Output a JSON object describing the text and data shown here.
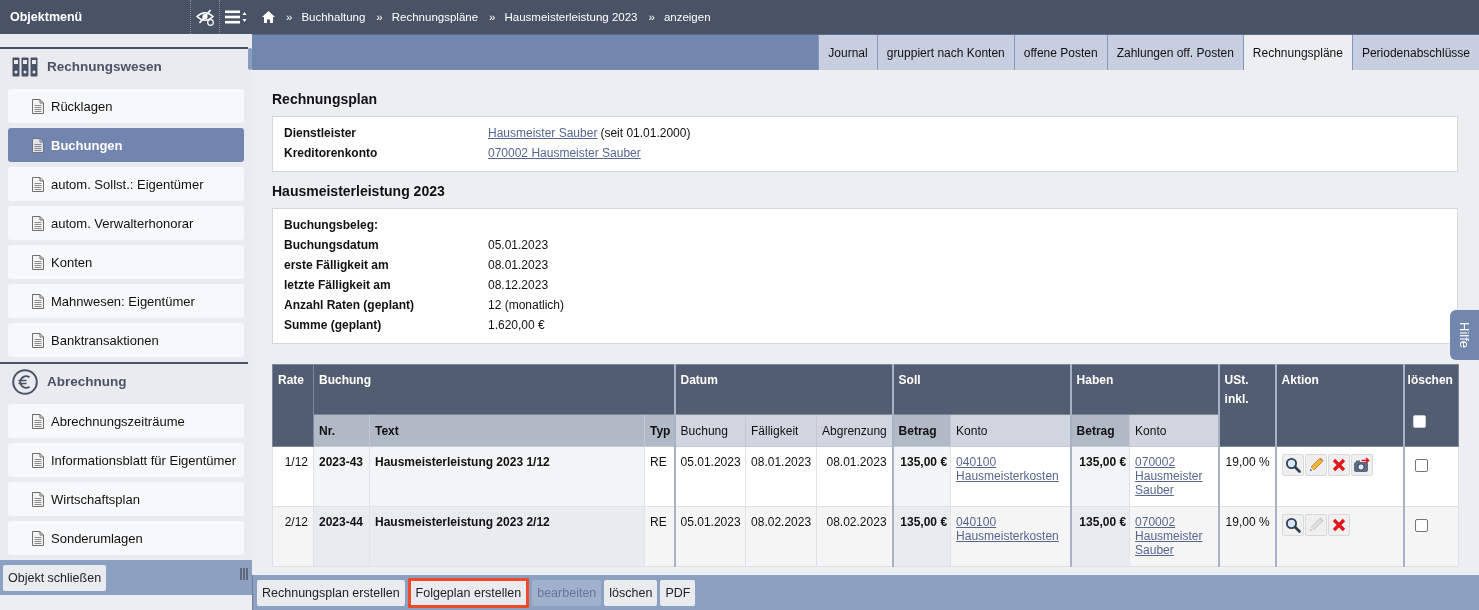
{
  "sidebar": {
    "title": "Objektmenü",
    "sections": [
      {
        "title": "Rechnungswesen",
        "kind": "binders",
        "items": [
          {
            "label": "Rücklagen",
            "selected": false
          },
          {
            "label": "Buchungen",
            "selected": true
          },
          {
            "label": "autom. Sollst.: Eigentümer",
            "selected": false
          },
          {
            "label": "autom. Verwalterhonorar",
            "selected": false
          },
          {
            "label": "Konten",
            "selected": false
          },
          {
            "label": "Mahnwesen: Eigentümer",
            "selected": false
          },
          {
            "label": "Banktransaktionen",
            "selected": false
          }
        ]
      },
      {
        "title": "Abrechnung",
        "kind": "euro",
        "items": [
          {
            "label": "Abrechnungszeiträume",
            "selected": false
          },
          {
            "label": "Informationsblatt für Eigentümer",
            "selected": false
          },
          {
            "label": "Wirtschaftsplan",
            "selected": false
          },
          {
            "label": "Sonderumlagen",
            "selected": false
          }
        ]
      }
    ],
    "close_button": "Objekt schließen"
  },
  "breadcrumb": {
    "separator": "»",
    "items": [
      "Buchhaltung",
      "Rechnungspläne",
      "Hausmeisterleistung 2023",
      "anzeigen"
    ]
  },
  "tabs": [
    {
      "label": "Journal",
      "selected": false
    },
    {
      "label": "gruppiert nach Konten",
      "selected": false
    },
    {
      "label": "offene Posten",
      "selected": false
    },
    {
      "label": "Zahlungen off. Posten",
      "selected": false
    },
    {
      "label": "Rechnungspläne",
      "selected": true
    },
    {
      "label": "Periodenabschlüsse",
      "selected": false
    }
  ],
  "plan": {
    "title": "Rechnungsplan",
    "fields": [
      {
        "label": "Dienstleister",
        "link": "Hausmeister Sauber",
        "value": "(seit 01.01.2000)"
      },
      {
        "label": "Kreditorenkonto",
        "link": "070002 Hausmeister Sauber"
      }
    ]
  },
  "details": {
    "title": "Hausmeisterleistung 2023",
    "fields": [
      {
        "label": "Buchungsbeleg:"
      },
      {
        "label": "Buchungsdatum",
        "value": "05.01.2023"
      },
      {
        "label": "erste Fälligkeit am",
        "value": "08.01.2023"
      },
      {
        "label": "letzte Fälligkeit am",
        "value": "08.12.2023"
      },
      {
        "label": "Anzahl Raten (geplant)",
        "value": "12 (monatlich)"
      },
      {
        "label": "Summe (geplant)",
        "value": "1.620,00 €"
      }
    ]
  },
  "help_tab": "Hilfe",
  "table": {
    "columns": [
      {
        "label": "Rate"
      },
      {
        "label": "Buchung",
        "sub": [
          "Nr.",
          "Text",
          "Typ"
        ]
      },
      {
        "label": "Datum",
        "sub": [
          "Buchung",
          "Fälligkeit",
          "Abgrenzung"
        ]
      },
      {
        "label": "Soll",
        "sub": [
          "Betrag",
          "Konto"
        ]
      },
      {
        "label": "Haben",
        "sub": [
          "Betrag",
          "Konto"
        ]
      },
      {
        "label": "USt. inkl."
      },
      {
        "label": "Aktion"
      },
      {
        "label": "löschen",
        "select_all": {
          "checked": false
        }
      }
    ],
    "rows": [
      {
        "rate": "1/12",
        "nr": "2023-43",
        "text": "Hausmeisterleistung 2023 1/12",
        "type": "RE",
        "booking_date": "05.01.2023",
        "due_date": "08.01.2023",
        "accrual_date": "08.01.2023",
        "debit_amount": "135,00 €",
        "debit_account": "040100 Hausmeisterkosten",
        "credit_amount": "135,00 €",
        "credit_account": "070002 Hausmeister Sauber",
        "vat": "19,00 %",
        "actions": [
          {
            "kind": "view",
            "disabled": false
          },
          {
            "kind": "edit",
            "disabled": false
          },
          {
            "kind": "delete",
            "disabled": false
          },
          {
            "kind": "camera",
            "disabled": false
          }
        ],
        "checked": false
      },
      {
        "rate": "2/12",
        "nr": "2023-44",
        "text": "Hausmeisterleistung 2023 2/12",
        "type": "RE",
        "booking_date": "05.01.2023",
        "due_date": "08.02.2023",
        "accrual_date": "08.02.2023",
        "debit_amount": "135,00 €",
        "debit_account": "040100 Hausmeisterkosten",
        "credit_amount": "135,00 €",
        "credit_account": "070002 Hausmeister Sauber",
        "vat": "19,00 %",
        "actions": [
          {
            "kind": "view",
            "disabled": false
          },
          {
            "kind": "edit",
            "disabled": true
          },
          {
            "kind": "delete",
            "disabled": false
          }
        ],
        "checked": false
      }
    ]
  },
  "toolbar": {
    "buttons": [
      {
        "label": "Rechnungsplan erstellen",
        "disabled": false,
        "highlighted": false
      },
      {
        "label": "Folgeplan erstellen",
        "disabled": false,
        "highlighted": true
      },
      {
        "label": "bearbeiten",
        "disabled": true,
        "highlighted": false
      },
      {
        "label": "löschen",
        "disabled": false,
        "highlighted": false
      },
      {
        "label": "PDF",
        "disabled": false,
        "highlighted": false
      }
    ]
  }
}
